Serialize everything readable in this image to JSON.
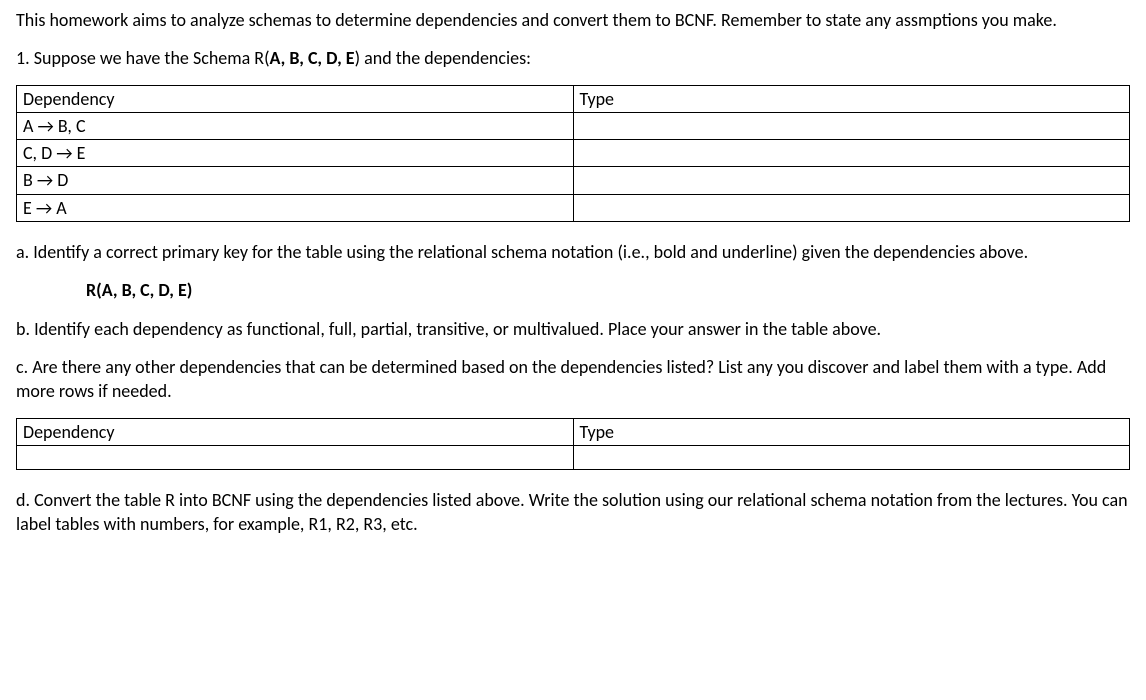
{
  "intro": "This homework aims to analyze schemas to determine dependencies and convert them to BCNF. Remember to state any assmptions you make.",
  "q1_intro_prefix": "1. Suppose we have the Schema R(",
  "q1_intro_bold": "A, B, C, D, E",
  "q1_intro_suffix": ") and the dependencies:",
  "table1": {
    "header_dependency": "Dependency",
    "header_type": "Type",
    "rows": [
      {
        "dep": "A → B, C",
        "type": ""
      },
      {
        "dep": "C, D → E",
        "type": ""
      },
      {
        "dep": "B → D",
        "type": ""
      },
      {
        "dep": "E → A",
        "type": ""
      }
    ]
  },
  "qa": "a. Identify a correct primary key for the table using the relational schema notation (i.e., bold and underline) given the dependencies above.",
  "schema_prefix": "R(",
  "schema_bold": "A, B, C, D, E",
  "schema_suffix": ")",
  "qb": "b. Identify each dependency as functional, full, partial, transitive, or multivalued. Place your answer in the table above.",
  "qc": "c. Are there any other dependencies that can be determined based on the dependencies listed? List any you discover and label them with a type. Add more rows if needed.",
  "table2": {
    "header_dependency": "Dependency",
    "header_type": "Type",
    "rows": [
      {
        "dep": "",
        "type": ""
      }
    ]
  },
  "qd": "d. Convert the table R into BCNF using the dependencies listed above. Write the solution using our relational schema notation from the lectures. You can label tables with numbers, for example, R1, R2, R3, etc."
}
